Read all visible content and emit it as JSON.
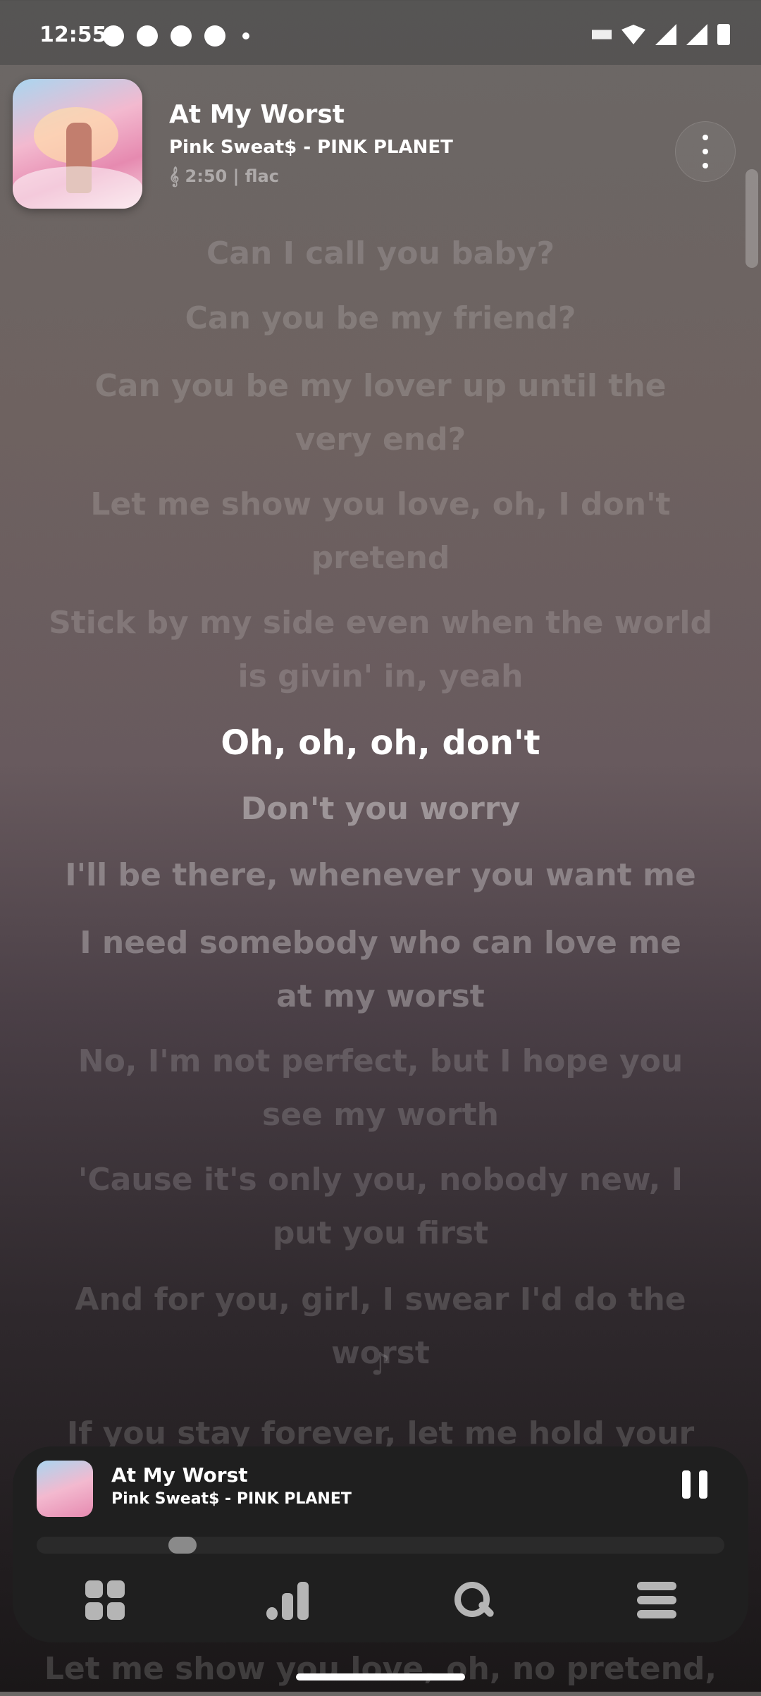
{
  "status_bar": {
    "time": "12:55",
    "notification_icons": [
      "messenger-icon",
      "chat-icon",
      "notification-icon",
      "browser-icon"
    ],
    "system_icons": [
      "nfc-icon",
      "wifi-icon",
      "cell-signal-icon",
      "battery-icon"
    ]
  },
  "now_playing": {
    "title": "At My Worst",
    "artist_album": "Pink Sweat$ - PINK PLANET",
    "meta": "𝄞 2:50 | flac",
    "more_icon": "more-vertical-icon"
  },
  "lyrics": [
    {
      "text": "Can I call you baby?",
      "state": "past"
    },
    {
      "text": "Can you be my friend?",
      "state": "past"
    },
    {
      "text": "Can you be my lover up until the very end?",
      "state": "past"
    },
    {
      "text": "Let me show you love, oh, I don't pretend",
      "state": "past"
    },
    {
      "text": "Stick by my side even when the world is givin' in, yeah",
      "state": "past"
    },
    {
      "text": "Oh, oh, oh, don't",
      "state": "active"
    },
    {
      "text": "Don't you worry",
      "state": "near"
    },
    {
      "text": "I'll be there, whenever you want me",
      "state": "mid"
    },
    {
      "text": "I need somebody who can love me at my worst",
      "state": "mid"
    },
    {
      "text": "No, I'm not perfect, but I hope you see my worth",
      "state": "future"
    },
    {
      "text": "'Cause it's only you, nobody new, I put you first",
      "state": "future"
    },
    {
      "text": "And for you, girl, I swear I'd do the worst",
      "state": "future"
    },
    {
      "text": "♪",
      "state": "future"
    },
    {
      "text": "If you stay forever, let me hold your",
      "state": "future"
    },
    {
      "text": "Let me show you love, oh, no pretend,",
      "state": "future"
    }
  ],
  "mini_player": {
    "title": "At My Worst",
    "artist_album": "Pink Sweat$ - PINK PLANET",
    "pause_icon": "pause-icon",
    "progress": 0.2
  },
  "bottom_nav": [
    {
      "name": "library",
      "icon": "grid-icon"
    },
    {
      "name": "stats",
      "icon": "bar-chart-icon"
    },
    {
      "name": "search",
      "icon": "search-icon"
    },
    {
      "name": "menu",
      "icon": "menu-icon"
    }
  ]
}
